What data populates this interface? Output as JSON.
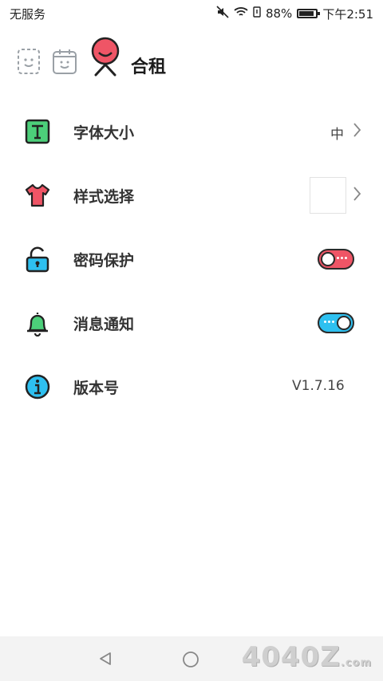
{
  "status": {
    "carrier": "无服务",
    "battery": "88%",
    "battery_level": 0.88,
    "time": "下午2:51"
  },
  "header": {
    "title": "合租"
  },
  "settings": [
    {
      "label": "字体大小",
      "value": "中",
      "icon": "font-t-icon"
    },
    {
      "label": "样式选择",
      "icon": "tshirt-icon"
    },
    {
      "label": "密码保护",
      "icon": "lock-icon",
      "toggle": "off"
    },
    {
      "label": "消息通知",
      "icon": "bell-icon",
      "toggle": "on"
    },
    {
      "label": "版本号",
      "value": "V1.7.16",
      "icon": "info-icon"
    }
  ],
  "watermark": {
    "text": "4040Z",
    "suffix": ".com"
  },
  "colors": {
    "accent_red": "#ef5566",
    "accent_blue": "#2ec0f0",
    "green": "#4ccf7a"
  }
}
